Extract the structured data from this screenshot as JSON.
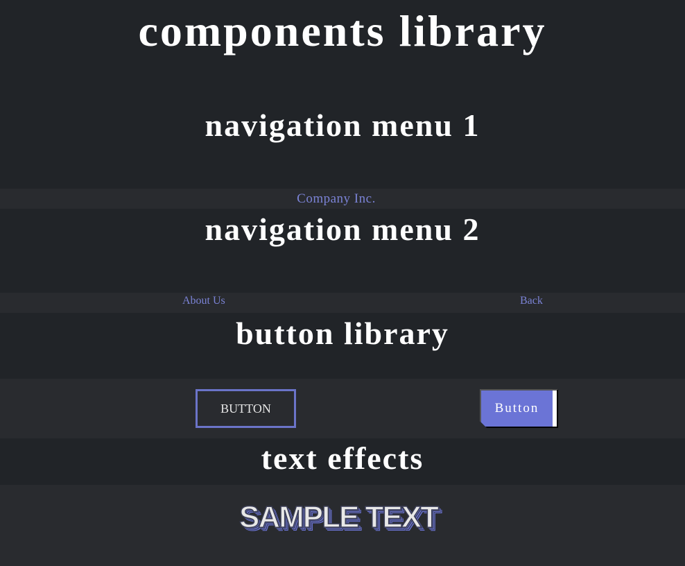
{
  "page": {
    "title": "components library"
  },
  "sections": {
    "nav1": {
      "title": "navigation menu 1",
      "brand_link": "Company Inc."
    },
    "nav2": {
      "title": "navigation menu 2",
      "left_link": "About Us",
      "right_link": "Back"
    },
    "buttons": {
      "title": "button library",
      "outline_button_label": "BUTTON",
      "fill_button_label": "Button"
    },
    "text_effects": {
      "title": "text effects",
      "sample_text": "SAMPLE TEXT"
    }
  },
  "colors": {
    "background": "#212428",
    "bar_background": "#292b2f",
    "accent": "#6b74d6",
    "link": "#7b83d6",
    "text": "#ffffff"
  }
}
